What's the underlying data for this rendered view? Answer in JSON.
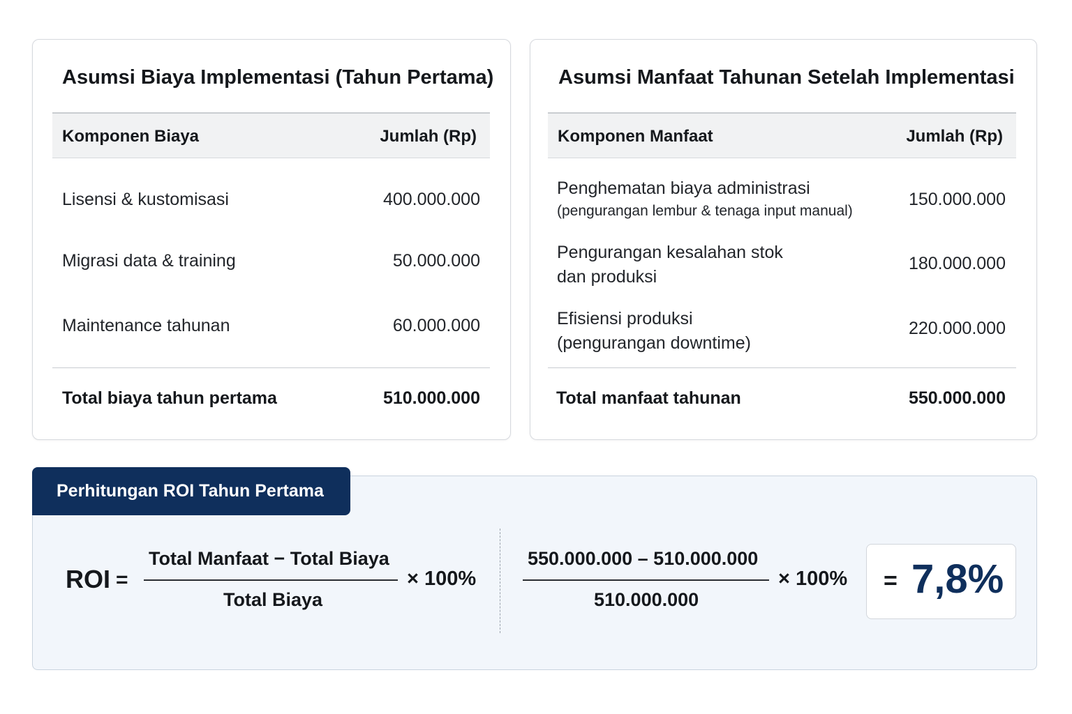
{
  "cost_card": {
    "title": "Asumsi Biaya Implementasi (Tahun Pertama)",
    "headers": {
      "component": "Komponen Biaya",
      "amount": "Jumlah (Rp)"
    },
    "rows": [
      {
        "label": "Lisensi & kustomisasi",
        "value": "400.000.000"
      },
      {
        "label": "Migrasi data & training",
        "value": "50.000.000"
      },
      {
        "label": "Maintenance tahunan",
        "value": "60.000.000"
      }
    ],
    "total": {
      "label": "Total biaya tahun pertama",
      "value": "510.000.000"
    }
  },
  "benefit_card": {
    "title": "Asumsi Manfaat Tahunan Setelah Implementasi",
    "headers": {
      "component": "Komponen Manfaat",
      "amount": "Jumlah (Rp)"
    },
    "rows": [
      {
        "label": "Penghematan biaya administrasi",
        "sub": "(pengurangan lembur & tenaga input manual)",
        "value": "150.000.000"
      },
      {
        "label": "Pengurangan kesalahan stok",
        "label2": "dan produksi",
        "value": "180.000.000"
      },
      {
        "label": "Efisiensi produksi",
        "label2": "(pengurangan downtime)",
        "value": "220.000.000"
      }
    ],
    "total": {
      "label": "Total manfaat tahunan",
      "value": "550.000.000"
    }
  },
  "roi": {
    "tab_title": "Perhitungan ROI Tahun Pertama",
    "label": "ROI",
    "equals": "=",
    "formula_numerator": "Total Manfaat  −  Total Biaya",
    "formula_denominator": "Total Biaya",
    "times": "× 100%",
    "calc_numerator": "550.000.000 – 510.000.000",
    "calc_denominator": "510.000.000",
    "result": "7,8%"
  }
}
